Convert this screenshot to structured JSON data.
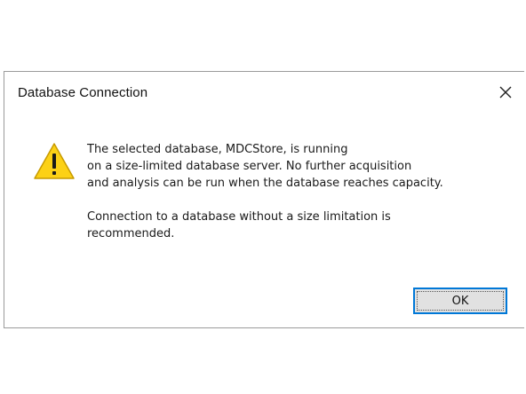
{
  "dialog": {
    "title": "Database Connection",
    "close_icon": "close-icon",
    "warning_icon": "warning-icon",
    "colors": {
      "warning_fill": "#fcd116",
      "warning_outline": "#c79a00",
      "ok_border": "#0078d7",
      "button_bg": "#e1e1e1"
    },
    "message_paragraph_1": "The selected database, MDCStore, is running\non a size-limited database server. No further acquisition\nand analysis can be run when the database reaches capacity.",
    "message_paragraph_2": "Connection to a database without a size limitation is\nrecommended.",
    "ok_label": "OK"
  }
}
